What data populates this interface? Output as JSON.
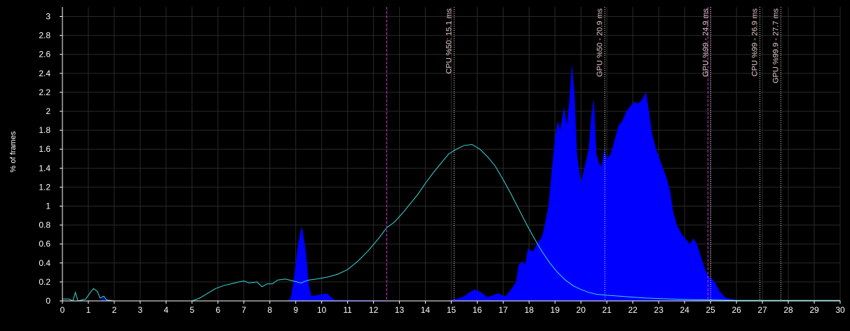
{
  "chart_data": {
    "type": "area",
    "ylabel": "% of frames",
    "xlim": [
      0,
      30
    ],
    "ylim": [
      0,
      3.1
    ],
    "x_ticks": [
      "0",
      "1",
      "2",
      "3",
      "4",
      "5",
      "6",
      "7",
      "8",
      "9",
      "10",
      "11",
      "12",
      "13",
      "14",
      "15",
      "16",
      "17",
      "18",
      "19",
      "20",
      "21",
      "22",
      "23",
      "24",
      "25",
      "26",
      "27",
      "28",
      "29",
      "30"
    ],
    "y_ticks": [
      "0",
      "0.2",
      "0.4",
      "0.6",
      "0.8",
      "1",
      "1.2",
      "1.4",
      "1.6",
      "1.8",
      "2",
      "2.2",
      "2.4",
      "2.6",
      "2.8",
      "3"
    ],
    "grid": true,
    "series": [
      {
        "kind": "area",
        "color": "#0000ff",
        "points": [
          [
            0,
            0
          ],
          [
            1.5,
            0
          ],
          [
            1.55,
            0.05
          ],
          [
            1.65,
            0
          ],
          [
            8.6,
            0
          ],
          [
            8.8,
            0.02
          ],
          [
            8.9,
            0.18
          ],
          [
            9.0,
            0.4
          ],
          [
            9.1,
            0.62
          ],
          [
            9.2,
            0.75
          ],
          [
            9.25,
            0.78
          ],
          [
            9.3,
            0.68
          ],
          [
            9.4,
            0.5
          ],
          [
            9.5,
            0.18
          ],
          [
            9.6,
            0.05
          ],
          [
            10.2,
            0.08
          ],
          [
            10.5,
            0.01
          ],
          [
            14.8,
            0
          ],
          [
            15.2,
            0.02
          ],
          [
            15.5,
            0.05
          ],
          [
            15.7,
            0.09
          ],
          [
            15.9,
            0.12
          ],
          [
            16.1,
            0.1
          ],
          [
            16.4,
            0.04
          ],
          [
            16.8,
            0.08
          ],
          [
            17.1,
            0.05
          ],
          [
            17.3,
            0.12
          ],
          [
            17.5,
            0.2
          ],
          [
            17.6,
            0.38
          ],
          [
            17.75,
            0.42
          ],
          [
            17.85,
            0.38
          ],
          [
            17.95,
            0.55
          ],
          [
            18.15,
            0.52
          ],
          [
            18.3,
            0.6
          ],
          [
            18.5,
            0.68
          ],
          [
            18.6,
            0.8
          ],
          [
            18.75,
            1.0
          ],
          [
            18.9,
            1.45
          ],
          [
            19.0,
            1.72
          ],
          [
            19.1,
            1.9
          ],
          [
            19.2,
            1.8
          ],
          [
            19.35,
            2.05
          ],
          [
            19.45,
            1.85
          ],
          [
            19.55,
            2.1
          ],
          [
            19.65,
            2.5
          ],
          [
            19.75,
            2.2
          ],
          [
            19.85,
            1.55
          ],
          [
            20.0,
            1.25
          ],
          [
            20.15,
            1.42
          ],
          [
            20.3,
            1.6
          ],
          [
            20.4,
            1.95
          ],
          [
            20.5,
            2.13
          ],
          [
            20.6,
            1.55
          ],
          [
            20.7,
            1.45
          ],
          [
            20.8,
            1.42
          ],
          [
            20.9,
            1.6
          ],
          [
            21.0,
            1.5
          ],
          [
            21.15,
            1.55
          ],
          [
            21.3,
            1.7
          ],
          [
            21.45,
            1.85
          ],
          [
            21.6,
            1.9
          ],
          [
            21.75,
            2.0
          ],
          [
            21.9,
            2.05
          ],
          [
            22.05,
            2.1
          ],
          [
            22.2,
            2.08
          ],
          [
            22.35,
            2.12
          ],
          [
            22.5,
            2.2
          ],
          [
            22.6,
            2.05
          ],
          [
            22.75,
            1.75
          ],
          [
            22.9,
            1.6
          ],
          [
            23.1,
            1.45
          ],
          [
            23.3,
            1.3
          ],
          [
            23.45,
            1.15
          ],
          [
            23.55,
            0.95
          ],
          [
            23.7,
            0.8
          ],
          [
            23.9,
            0.7
          ],
          [
            24.05,
            0.65
          ],
          [
            24.2,
            0.6
          ],
          [
            24.35,
            0.66
          ],
          [
            24.5,
            0.58
          ],
          [
            24.65,
            0.45
          ],
          [
            24.8,
            0.32
          ],
          [
            24.95,
            0.25
          ],
          [
            25.1,
            0.22
          ],
          [
            25.2,
            0.18
          ],
          [
            25.35,
            0.1
          ],
          [
            25.6,
            0.03
          ],
          [
            26.0,
            0.01
          ],
          [
            30,
            0
          ]
        ]
      },
      {
        "kind": "line",
        "color": "#3cd8d8",
        "points": [
          [
            0,
            0.02
          ],
          [
            0.25,
            0.02
          ],
          [
            0.4,
            0.0
          ],
          [
            0.5,
            0.09
          ],
          [
            0.6,
            0.0
          ],
          [
            0.9,
            0.02
          ],
          [
            1.1,
            0.1
          ],
          [
            1.2,
            0.13
          ],
          [
            1.35,
            0.1
          ],
          [
            1.45,
            0.03
          ],
          [
            1.6,
            0.05
          ],
          [
            1.7,
            0.01
          ],
          [
            2,
            0
          ],
          [
            5,
            0
          ],
          [
            5.3,
            0.03
          ],
          [
            5.6,
            0.08
          ],
          [
            5.9,
            0.13
          ],
          [
            6.2,
            0.16
          ],
          [
            6.5,
            0.18
          ],
          [
            6.8,
            0.2
          ],
          [
            7.0,
            0.21
          ],
          [
            7.2,
            0.19
          ],
          [
            7.5,
            0.2
          ],
          [
            7.7,
            0.15
          ],
          [
            7.9,
            0.18
          ],
          [
            8.1,
            0.18
          ],
          [
            8.3,
            0.22
          ],
          [
            8.6,
            0.23
          ],
          [
            8.9,
            0.21
          ],
          [
            9.2,
            0.19
          ],
          [
            9.5,
            0.22
          ],
          [
            9.8,
            0.23
          ],
          [
            10.2,
            0.25
          ],
          [
            10.6,
            0.28
          ],
          [
            11.0,
            0.33
          ],
          [
            11.4,
            0.42
          ],
          [
            11.8,
            0.53
          ],
          [
            12.2,
            0.66
          ],
          [
            12.5,
            0.77
          ],
          [
            12.8,
            0.83
          ],
          [
            13.1,
            0.92
          ],
          [
            13.4,
            1.02
          ],
          [
            13.7,
            1.12
          ],
          [
            14.0,
            1.24
          ],
          [
            14.3,
            1.35
          ],
          [
            14.6,
            1.45
          ],
          [
            14.9,
            1.55
          ],
          [
            15.2,
            1.6
          ],
          [
            15.5,
            1.64
          ],
          [
            15.8,
            1.65
          ],
          [
            16.1,
            1.6
          ],
          [
            16.4,
            1.52
          ],
          [
            16.7,
            1.42
          ],
          [
            17.0,
            1.28
          ],
          [
            17.3,
            1.13
          ],
          [
            17.6,
            0.97
          ],
          [
            17.9,
            0.81
          ],
          [
            18.2,
            0.66
          ],
          [
            18.5,
            0.52
          ],
          [
            18.8,
            0.4
          ],
          [
            19.1,
            0.3
          ],
          [
            19.4,
            0.22
          ],
          [
            19.7,
            0.16
          ],
          [
            20.0,
            0.12
          ],
          [
            20.3,
            0.09
          ],
          [
            20.6,
            0.07
          ],
          [
            21.0,
            0.06
          ],
          [
            21.5,
            0.05
          ],
          [
            22.0,
            0.04
          ],
          [
            22.5,
            0.03
          ],
          [
            23.0,
            0.025
          ],
          [
            23.5,
            0.02
          ],
          [
            24.0,
            0.015
          ],
          [
            25.0,
            0.01
          ],
          [
            26.0,
            0.005
          ],
          [
            28.0,
            0.005
          ],
          [
            30,
            0.005
          ]
        ]
      }
    ],
    "markers": [
      {
        "x": 12.5,
        "color": "#cc33cc",
        "style": "dashed",
        "label": ""
      },
      {
        "x": 15.1,
        "color": "#e0e0e0",
        "style": "dotted",
        "label": "CPU %50: 15.1 ms"
      },
      {
        "x": 20.9,
        "color": "#e0e0e0",
        "style": "dotted",
        "label": "GPU %50 - 20.9 ms"
      },
      {
        "x": 24.9,
        "color": "#cc33cc",
        "style": "dashed",
        "label": ""
      },
      {
        "x": 25.0,
        "color": "#e0e0e0",
        "style": "dotted",
        "label": "GPU %99 - 24.9 ms"
      },
      {
        "x": 26.9,
        "color": "#e0e0e0",
        "style": "dotted",
        "label": "CPU %99 - 26.9 ms"
      },
      {
        "x": 27.7,
        "color": "#e0e0e0",
        "style": "dotted",
        "label": "GPU %99.9 - 27.7 ms"
      }
    ]
  }
}
